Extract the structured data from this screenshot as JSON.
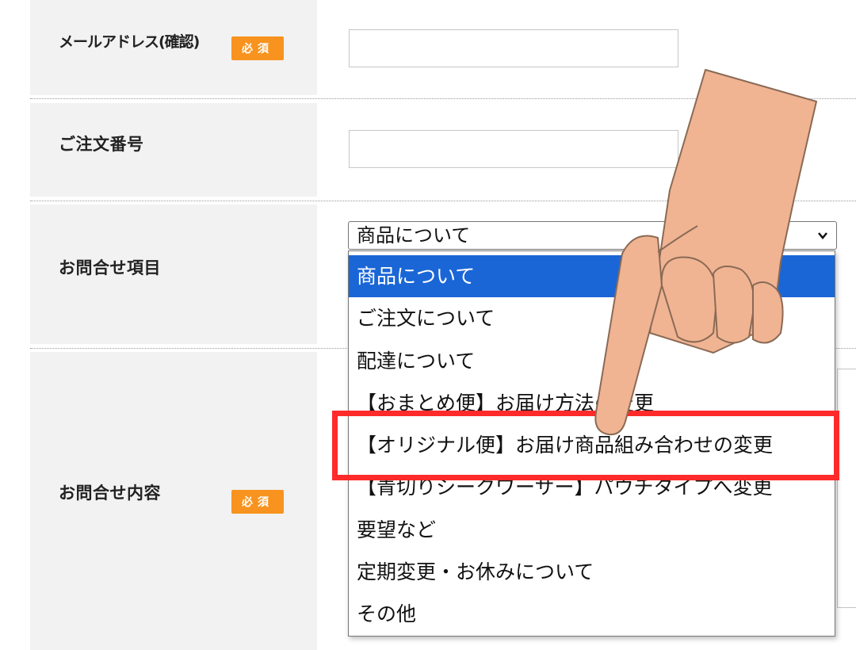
{
  "form": {
    "email_confirm": {
      "label": "メールアドレス(確認)",
      "badge": "必須",
      "value": ""
    },
    "order_number": {
      "label": "ご注文番号",
      "value": ""
    },
    "inquiry_item": {
      "label": "お問合せ項目",
      "selected": "商品について",
      "options": [
        "商品について",
        "ご注文について",
        "配達について",
        "【おまとめ便】お届け方法の変更",
        "【オリジナル便】お届け商品組み合わせの変更",
        "【青切りシークワーサー】パウチタイプへ変更",
        "要望など",
        "定期変更・お休みについて",
        "その他"
      ],
      "highlighted_index": 4
    },
    "inquiry_content": {
      "label": "お問合せ内容",
      "badge": "必須"
    }
  },
  "colors": {
    "badge": "#f7931e",
    "selected_option": "#1a66d6",
    "highlight_box": "#ff2b2b",
    "hand": "#f0b493"
  },
  "icons": {
    "pointer": "pointing-hand-icon",
    "select_arrow": "chevron-down-icon"
  }
}
